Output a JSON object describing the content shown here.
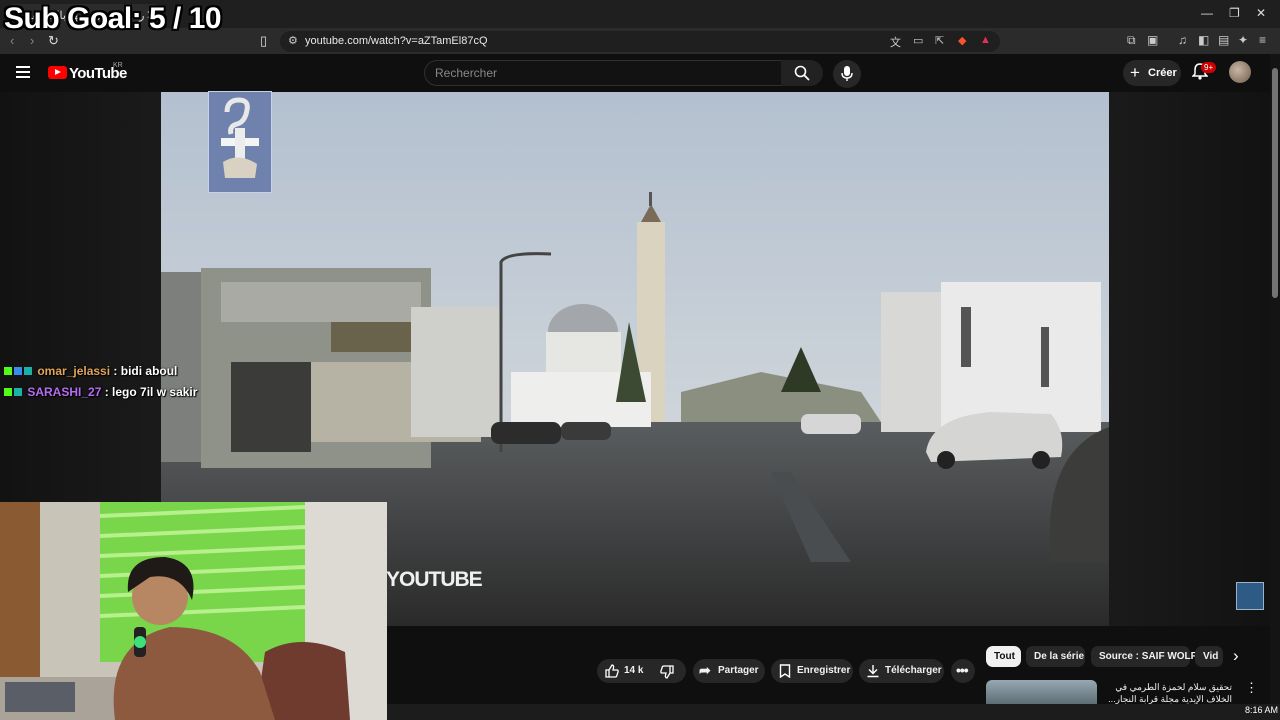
{
  "overlay": {
    "sub_goal": "Sub Goal: 5 / 10"
  },
  "browser": {
    "tab_title": "انقطاع أرخص صدى شهد بالمنطقة",
    "url": "youtube.com/watch?v=aZTamEl87cQ"
  },
  "youtube": {
    "logo_text": "YouTube",
    "region": "KR",
    "search_placeholder": "Rechercher",
    "create_label": "Créer",
    "notification_count": "9+"
  },
  "video": {
    "watermark": "YOUTUBE"
  },
  "actions": {
    "like_count": "14 k",
    "share": "Partager",
    "save": "Enregistrer",
    "download": "Télécharger"
  },
  "chips": [
    {
      "label": "Tout",
      "active": true
    },
    {
      "label": "De la série"
    },
    {
      "label": "Source : SAIF WOLF"
    },
    {
      "label": "Vid"
    }
  ],
  "recommended": [
    {
      "title": "تحقيق سلام لحمزة الطرمي في الخلاف الإيدية مجلة قرابة النجار..."
    }
  ],
  "chat": [
    {
      "user": "omar_jelassi",
      "color": "#e0a45a",
      "message": "bidi aboul"
    },
    {
      "user": "SARASHI_27",
      "color": "#b56cf2",
      "message": "lego 7il w sakir"
    }
  ],
  "taskbar": {
    "time": "8:16 AM"
  },
  "colors": {
    "youtube_red": "#ff0000",
    "background": "#0f0f0f",
    "chip_bg": "#272727"
  }
}
